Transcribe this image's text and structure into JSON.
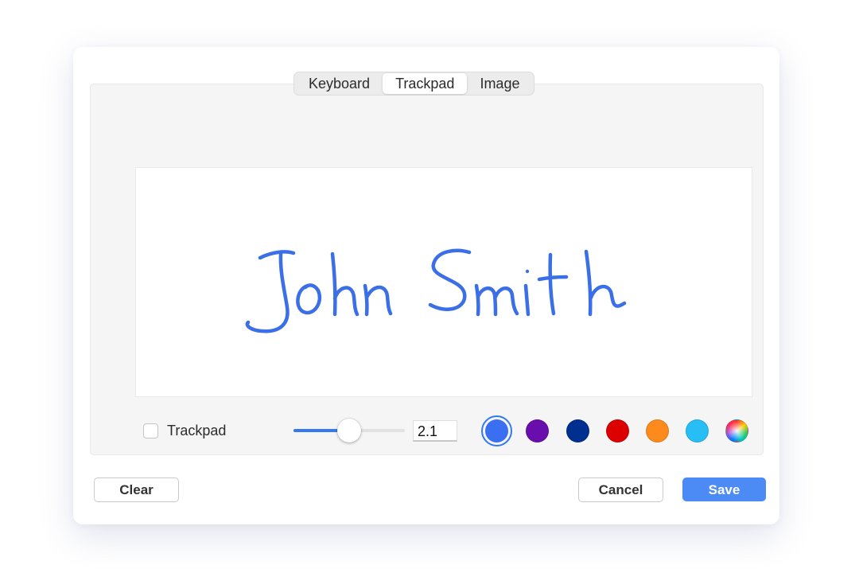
{
  "tabs": [
    {
      "label": "Keyboard",
      "active": false
    },
    {
      "label": "Trackpad",
      "active": true
    },
    {
      "label": "Image",
      "active": false
    }
  ],
  "signature": {
    "text": "John Smith",
    "ink_color": "#3a6fe8"
  },
  "controls": {
    "trackpad_checkbox_label": "Trackpad",
    "trackpad_checked": false,
    "stroke_size_value": "2.1",
    "stroke_slider_level": 0.5
  },
  "colors": [
    {
      "name": "blue",
      "hex": "#3a6ff2",
      "selected": true
    },
    {
      "name": "purple",
      "hex": "#6a0dad",
      "selected": false
    },
    {
      "name": "navy",
      "hex": "#00308f",
      "selected": false
    },
    {
      "name": "red",
      "hex": "#dc0000",
      "selected": false
    },
    {
      "name": "orange",
      "hex": "#fc8a1d",
      "selected": false
    },
    {
      "name": "cyan",
      "hex": "#27bdf5",
      "selected": false
    },
    {
      "name": "custom",
      "hex": "conic",
      "selected": false
    }
  ],
  "buttons": {
    "clear": "Clear",
    "cancel": "Cancel",
    "save": "Save"
  },
  "accent_color": "#3478f6"
}
